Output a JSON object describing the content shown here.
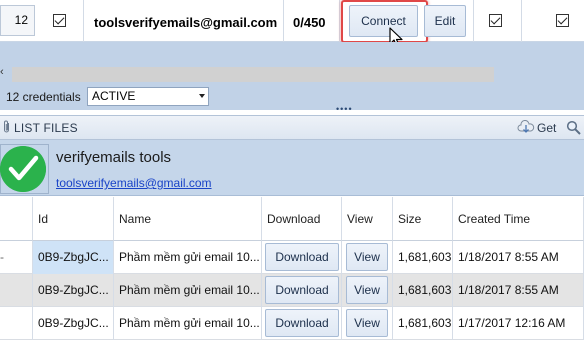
{
  "credential_row": {
    "number": "12",
    "email": "toolsverifyemails@gmail.com",
    "count": "0/450",
    "connect_label": "Connect",
    "edit_label": "Edit"
  },
  "status_bar": {
    "credentials_count": "12 credentials",
    "status_value": "ACTIVE"
  },
  "list_files": {
    "title": "LIST FILES",
    "get_label": "Get"
  },
  "account": {
    "name": "verifyemails tools",
    "email": "toolsverifyemails@gmail.com"
  },
  "table": {
    "columns": [
      "Id",
      "Name",
      "Download",
      "View",
      "Size",
      "Created Time"
    ],
    "rows": [
      {
        "id": "0B9-ZbgJC...",
        "name": "Phầm mềm gửi email 10...",
        "download": "Download",
        "view": "View",
        "size": "1,681,603",
        "created": "1/18/2017 8:55 AM"
      },
      {
        "id": "0B9-ZbgJC...",
        "name": "Phầm mềm gửi email 10...",
        "download": "Download",
        "view": "View",
        "size": "1,681,603",
        "created": "1/18/2017 8:55 AM"
      },
      {
        "id": "0B9-ZbgJC...",
        "name": "Phầm mềm gửi email 10...",
        "download": "Download",
        "view": "View",
        "size": "1,681,603",
        "created": "1/17/2017 12:16 AM"
      }
    ]
  },
  "colors": {
    "band": "#c1d2e7",
    "highlight": "#e04848",
    "avatar": "#2bb24c",
    "link": "#1a44c8"
  },
  "icons": [
    "checkbox-checked-icon",
    "paperclip-icon",
    "cloud-get-icon",
    "search-icon",
    "mouse-cursor-icon",
    "dropdown-arrow-icon"
  ]
}
